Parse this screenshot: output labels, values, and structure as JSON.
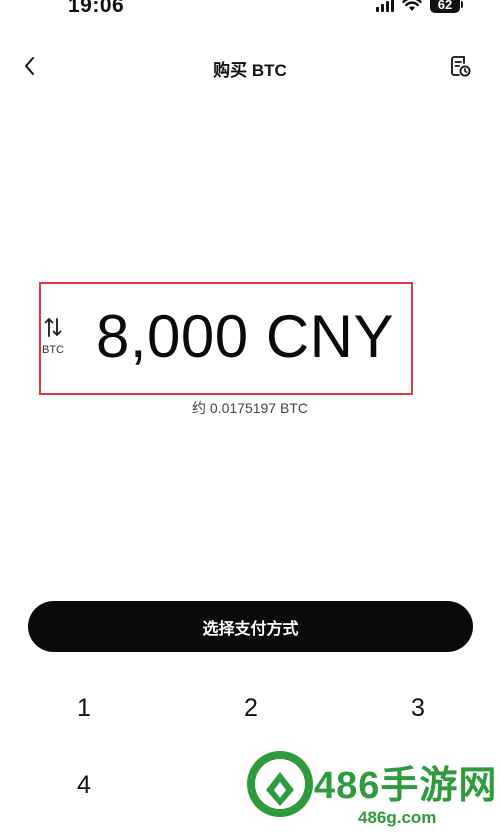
{
  "status_bar": {
    "time": "19:06",
    "battery": "62"
  },
  "nav": {
    "title": "购买 BTC",
    "back_icon": "chevron-left-icon",
    "history_icon": "order-history-icon"
  },
  "amount": {
    "value": "8,000 CNY",
    "swap_label": "BTC",
    "approx": "约 0.0175197 BTC"
  },
  "pay_button": {
    "label": "选择支付方式"
  },
  "keypad": {
    "keys": [
      "1",
      "2",
      "3",
      "4"
    ]
  },
  "watermark": {
    "text": "486手游网",
    "url": "486g.com"
  },
  "colors": {
    "highlight_border": "#e0393e",
    "button_bg": "#0a0a0a",
    "watermark_green": "#2f9a3e"
  }
}
